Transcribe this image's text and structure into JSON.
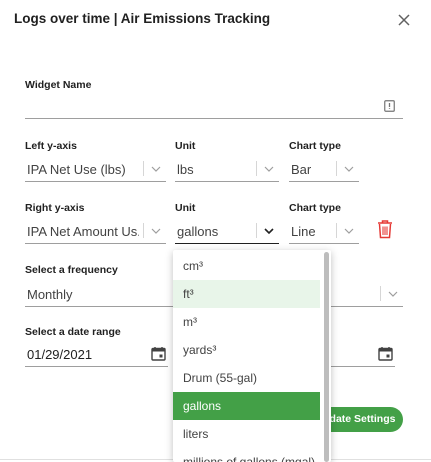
{
  "dialog": {
    "title": "Logs over time | Air Emissions Tracking",
    "widget_name": {
      "label": "Widget Name",
      "value": ""
    },
    "left_y_axis": {
      "label": "Left y-axis",
      "value": "IPA Net Use (lbs)"
    },
    "left_unit": {
      "label": "Unit",
      "value": "lbs"
    },
    "left_chart_type": {
      "label": "Chart type",
      "value": "Bar"
    },
    "right_y_axis": {
      "label": "Right y-axis",
      "value": "IPA Net Amount Us..."
    },
    "right_unit": {
      "label": "Unit",
      "value": "gallons"
    },
    "right_chart_type": {
      "label": "Chart type",
      "value": "Line"
    },
    "frequency": {
      "label": "Select a frequency",
      "value": "Monthly"
    },
    "date_range": {
      "label": "Select a date range",
      "start": "01/29/2021",
      "end": ""
    },
    "update_button": "date Settings"
  },
  "unit_dropdown": {
    "options": [
      "cm³",
      "ft³",
      "m³",
      "yards³",
      "Drum (55-gal)",
      "gallons",
      "liters",
      "millions of gallons (mgal)"
    ],
    "hovered_option": "ft³",
    "selected_option": "gallons"
  },
  "colors": {
    "accent": "#43a047",
    "hover": "#e8f5e9",
    "danger": "#e53935"
  }
}
